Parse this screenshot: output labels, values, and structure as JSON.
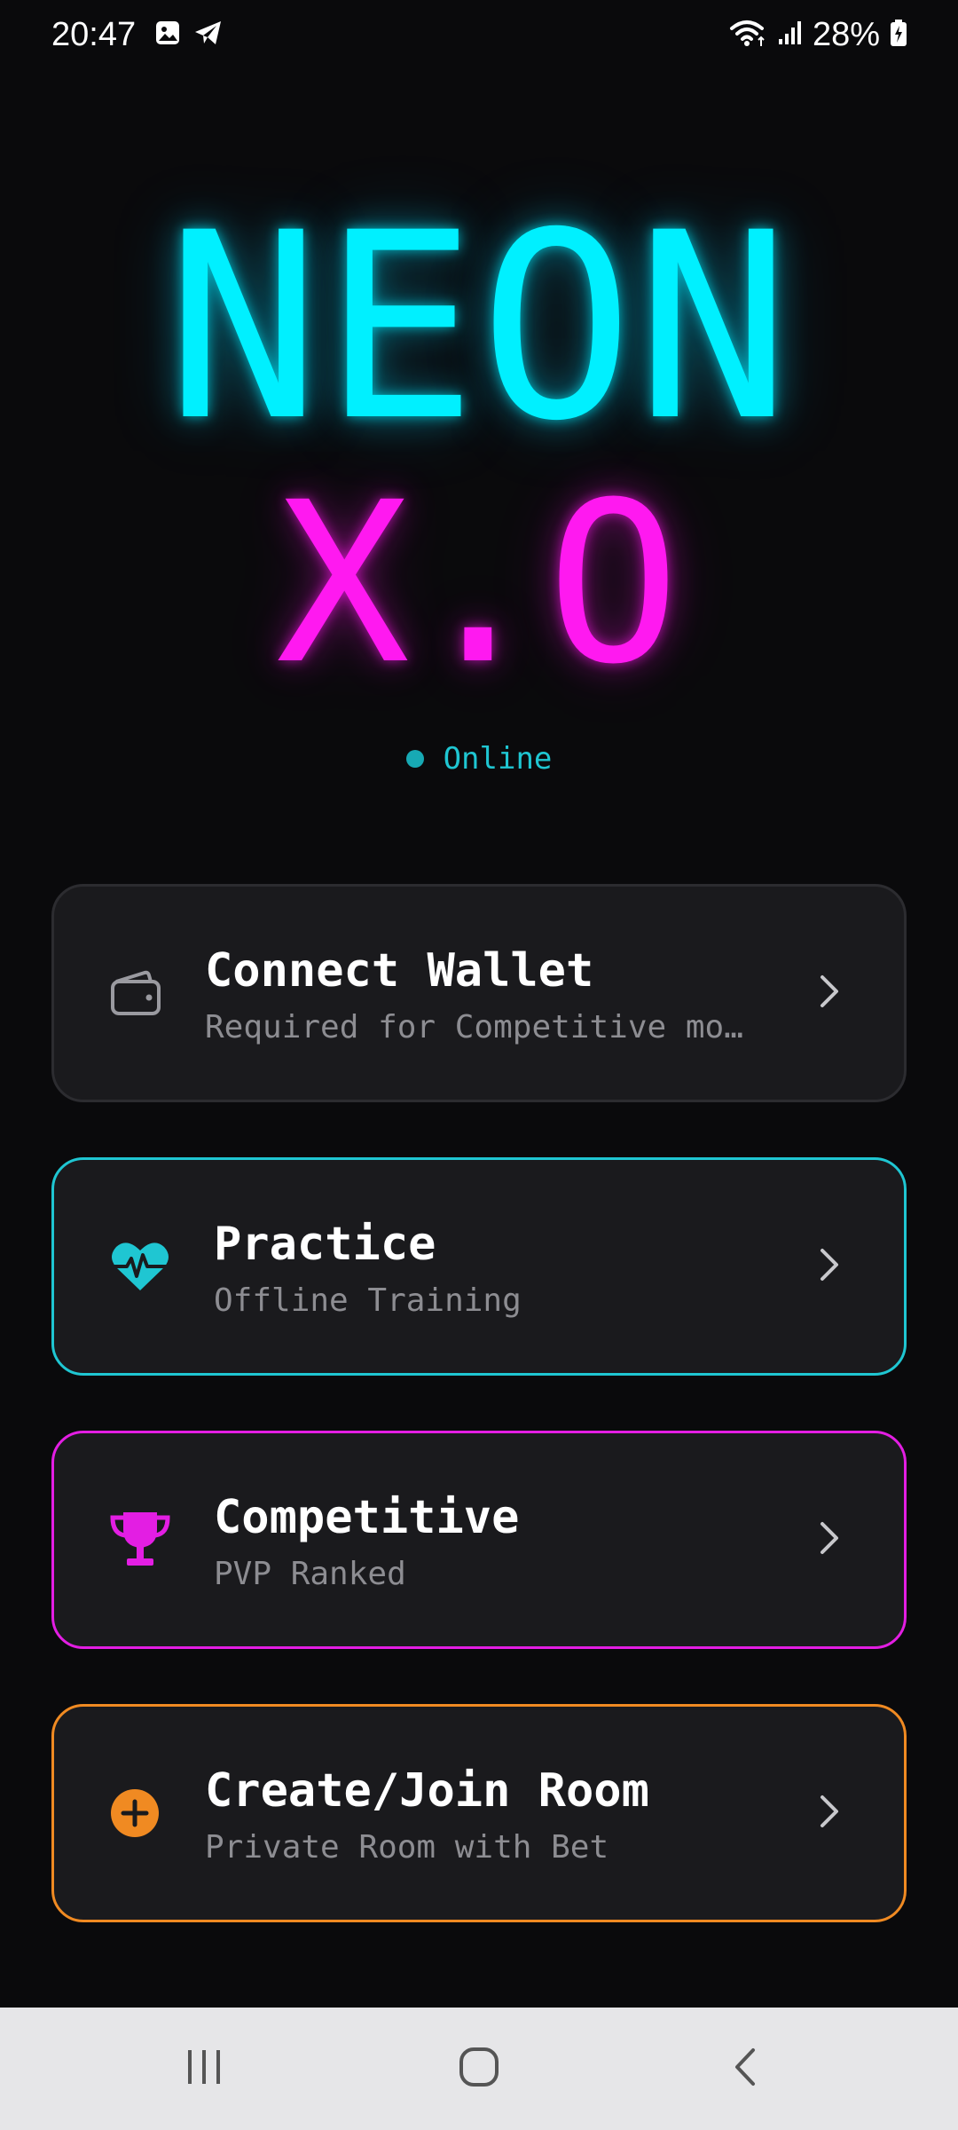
{
  "status_bar": {
    "time": "20:47",
    "battery": "28%",
    "left_icons": [
      "gallery-icon",
      "telegram-icon"
    ],
    "right_icons": [
      "wifi-icon",
      "signal-icon",
      "battery-charging-icon"
    ]
  },
  "logo": {
    "line1": "NEON",
    "line2": "X.O"
  },
  "status": {
    "label": "Online"
  },
  "menu": [
    {
      "title": "Connect Wallet",
      "subtitle": "Required for Competitive mo…",
      "icon": "wallet-icon"
    },
    {
      "title": "Practice",
      "subtitle": "Offline Training",
      "icon": "heart-pulse-icon"
    },
    {
      "title": "Competitive",
      "subtitle": "PVP Ranked",
      "icon": "trophy-icon"
    },
    {
      "title": "Create/Join Room",
      "subtitle": "Private Room with Bet",
      "icon": "plus-circle-icon"
    }
  ],
  "nav": [
    "recent-apps-icon",
    "home-icon",
    "back-icon"
  ],
  "colors": {
    "background": "#0a0a0c",
    "cyan": "#00f0ff",
    "magenta": "#ff19f0",
    "teal_border": "#1fc6d2",
    "pink_border": "#e31ee3",
    "orange_border": "#f08a22",
    "card_bg": "#1a1a1d"
  }
}
